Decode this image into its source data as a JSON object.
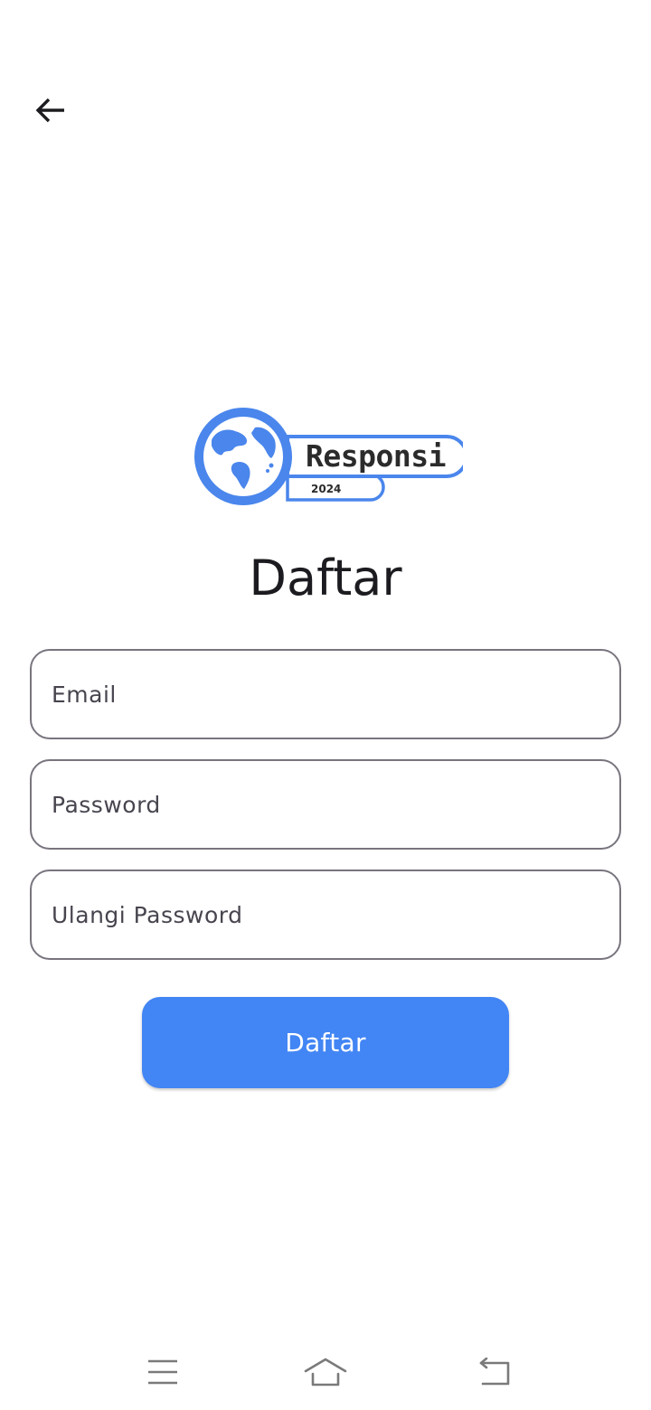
{
  "header": {
    "back_icon": "arrow-left-icon"
  },
  "logo": {
    "brand": "Responsi",
    "year": "2024",
    "icon": "globe-icon",
    "color": "#4285f4"
  },
  "page_title": "Daftar",
  "form": {
    "email_placeholder": "Email",
    "password_placeholder": "Password",
    "repeat_password_placeholder": "Ulangi Password",
    "submit_label": "Daftar"
  },
  "colors": {
    "accent": "#4285f4",
    "field_border": "#79747e",
    "title_text": "#1c1b1f",
    "placeholder_text": "#49454f"
  },
  "system_nav": {
    "menu_icon": "menu-icon",
    "home_icon": "home-icon",
    "back_icon": "back-icon"
  }
}
